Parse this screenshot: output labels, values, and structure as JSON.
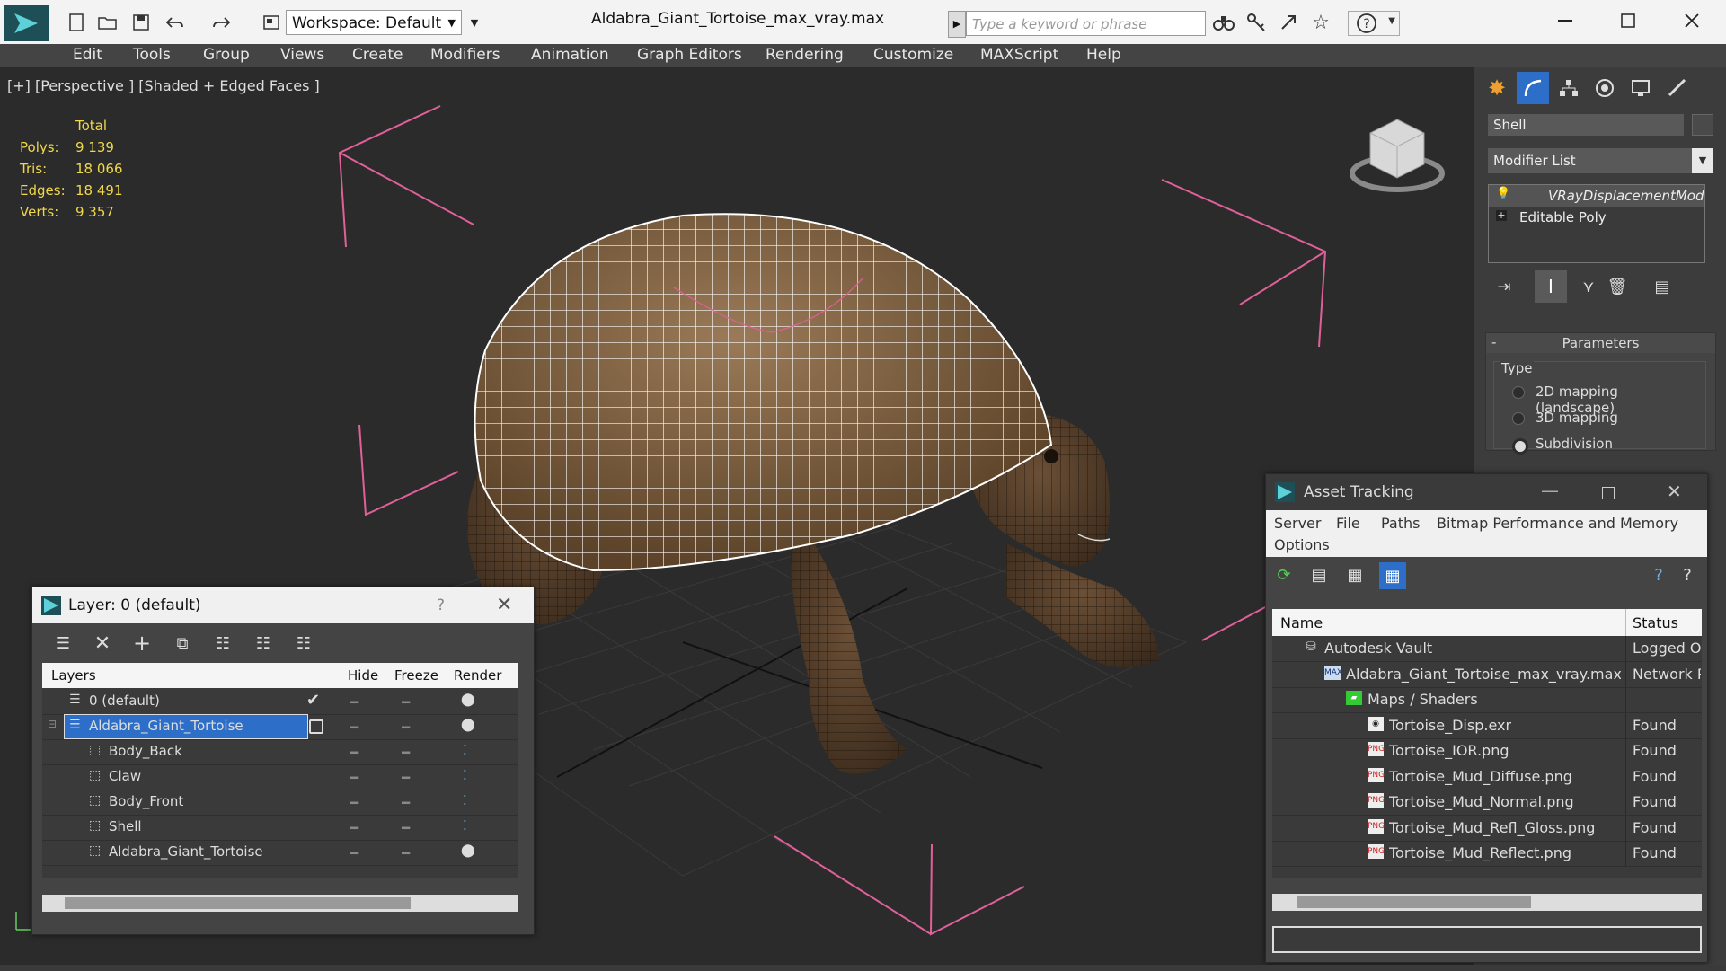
{
  "window": {
    "title": "Aldabra_Giant_Tortoise_max_vray.max",
    "workspace": "Workspace: Default",
    "search_placeholder": "Type a keyword or phrase"
  },
  "menu": [
    "Edit",
    "Tools",
    "Group",
    "Views",
    "Create",
    "Modifiers",
    "Animation",
    "Graph Editors",
    "Rendering",
    "Customize",
    "MAXScript",
    "Help"
  ],
  "viewport": {
    "label": "[+] [Perspective ] [Shaded + Edged Faces ]",
    "stats": {
      "total_label": "Total",
      "rows": [
        {
          "k": "Polys:",
          "v": "9 139"
        },
        {
          "k": "Tris:",
          "v": "18 066"
        },
        {
          "k": "Edges:",
          "v": "18 491"
        },
        {
          "k": "Verts:",
          "v": "9 357"
        }
      ]
    }
  },
  "command_panel": {
    "object_name": "Shell",
    "modifier_list": "Modifier List",
    "stack": [
      "VRayDisplacementMod",
      "Editable Poly"
    ],
    "rollout_title": "Parameters",
    "type_label": "Type",
    "options": [
      "2D mapping (landscape)",
      "3D mapping",
      "Subdivision"
    ],
    "selected_option": "Subdivision"
  },
  "layer_explorer": {
    "title": "Layer: 0 (default)",
    "help": "?",
    "columns": [
      "Layers",
      "Hide",
      "Freeze",
      "Render"
    ],
    "rows": [
      {
        "name": "0 (default)",
        "level": 0
      },
      {
        "name": "Aldabra_Giant_Tortoise",
        "level": 0,
        "selected": true
      },
      {
        "name": "Body_Back",
        "level": 1
      },
      {
        "name": "Claw",
        "level": 1
      },
      {
        "name": "Body_Front",
        "level": 1
      },
      {
        "name": "Shell",
        "level": 1
      },
      {
        "name": "Aldabra_Giant_Tortoise",
        "level": 1
      }
    ]
  },
  "asset_tracking": {
    "title": "Asset Tracking",
    "menu": [
      "Server",
      "File",
      "Paths",
      "Bitmap Performance and Memory",
      "Options"
    ],
    "columns": [
      "Name",
      "Status"
    ],
    "rows": [
      {
        "name": "Autodesk Vault",
        "status": "Logged O",
        "indent": 0,
        "icon": "vault-icon"
      },
      {
        "name": "Aldabra_Giant_Tortoise_max_vray.max",
        "status": "Network P",
        "indent": 1,
        "icon": "max-file-icon"
      },
      {
        "name": "Maps / Shaders",
        "status": "",
        "indent": 2,
        "icon": "maps-folder-icon"
      },
      {
        "name": "Tortoise_Disp.exr",
        "status": "Found",
        "indent": 3,
        "icon": "exr-file-icon"
      },
      {
        "name": "Tortoise_IOR.png",
        "status": "Found",
        "indent": 3,
        "icon": "png-file-icon"
      },
      {
        "name": "Tortoise_Mud_Diffuse.png",
        "status": "Found",
        "indent": 3,
        "icon": "png-file-icon"
      },
      {
        "name": "Tortoise_Mud_Normal.png",
        "status": "Found",
        "indent": 3,
        "icon": "png-file-icon"
      },
      {
        "name": "Tortoise_Mud_Refl_Gloss.png",
        "status": "Found",
        "indent": 3,
        "icon": "png-file-icon"
      },
      {
        "name": "Tortoise_Mud_Reflect.png",
        "status": "Found",
        "indent": 3,
        "icon": "png-file-icon"
      }
    ]
  },
  "colors": {
    "accent": "#2d6fc8",
    "stats": "#f0d84a",
    "gizmo": "#e0609a"
  }
}
